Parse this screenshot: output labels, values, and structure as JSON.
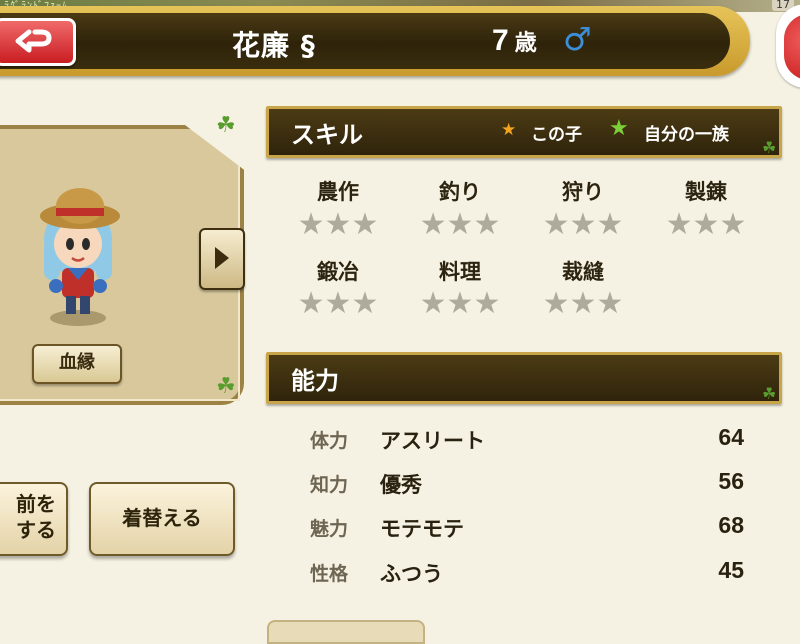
{
  "header": {
    "child_name": "花廉 §",
    "age_number": "7",
    "age_unit": "歳",
    "gender_symbol": "♂"
  },
  "status_bar": {
    "top_left_text": "ﾗｸﾞﾗﾝﾄﾞﾌｧｰﾑ",
    "top_right_text": "17"
  },
  "character_panel": {
    "lineage_button": "血縁"
  },
  "buttons": {
    "rename_line1": "前を",
    "rename_line2": "する",
    "change_clothes": "着替える"
  },
  "skills": {
    "title": "スキル",
    "legend_own": "この子",
    "legend_family": "自分の一族",
    "items": [
      {
        "name": "農作",
        "stars": "★★★"
      },
      {
        "name": "釣り",
        "stars": "★★★"
      },
      {
        "name": "狩り",
        "stars": "★★★"
      },
      {
        "name": "製錬",
        "stars": "★★★"
      },
      {
        "name": "鍛冶",
        "stars": "★★★"
      },
      {
        "name": "料理",
        "stars": "★★★"
      },
      {
        "name": "裁縫",
        "stars": "★★★"
      }
    ]
  },
  "abilities": {
    "title": "能力",
    "rows": [
      {
        "key": "体力",
        "value": "アスリート",
        "num": "64"
      },
      {
        "key": "知力",
        "value": "優秀",
        "num": "56"
      },
      {
        "key": "魅力",
        "value": "モテモテ",
        "num": "68"
      },
      {
        "key": "性格",
        "value": "ふつう",
        "num": "45"
      }
    ]
  },
  "colors": {
    "header_bg": "#2e230a",
    "gold_border": "#c99a2c",
    "panel_bg": "#f6f2e3",
    "star_empty": "#aeaa9c",
    "gender_male": "#3d8ed8"
  }
}
